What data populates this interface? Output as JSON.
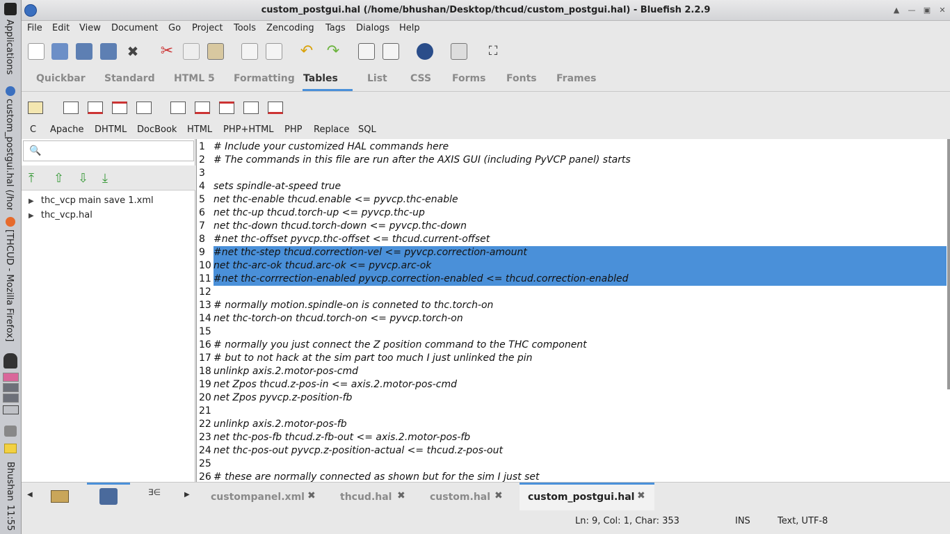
{
  "taskbar": {
    "applications": "Applications",
    "window1": "custom_postgui.hal (/hor",
    "window2": "[THCUD - Mozilla Firefox]",
    "user": "Bhushan",
    "time": "11:55"
  },
  "window": {
    "title": "custom_postgui.hal (/home/bhushan/Desktop/thcud/custom_postgui.hal) - Bluefish 2.2.9"
  },
  "menu": [
    "File",
    "Edit",
    "View",
    "Document",
    "Go",
    "Project",
    "Tools",
    "Zencoding",
    "Tags",
    "Dialogs",
    "Help"
  ],
  "toolbar_icons": [
    "new-file-icon",
    "open-file-icon",
    "save-icon",
    "save-as-icon",
    "close-icon",
    "cut-icon",
    "copy-icon",
    "paste-icon",
    "find-icon",
    "replace-icon",
    "undo-icon",
    "redo-icon",
    "unindent-icon",
    "indent-icon",
    "preview-browser-icon",
    "toggle-view-icon",
    "fullscreen-icon"
  ],
  "quickbar_tabs": [
    "Quickbar",
    "Standard",
    "HTML 5",
    "Formatting",
    "Tables",
    "List",
    "CSS",
    "Forms",
    "Fonts",
    "Frames"
  ],
  "active_tab": "Tables",
  "languages": [
    "C",
    "Apache",
    "DHTML",
    "DocBook",
    "HTML",
    "PHP+HTML",
    "PHP",
    "Replace",
    "SQL"
  ],
  "sidebar": {
    "search_placeholder": "",
    "files": [
      "thc_vcp main save 1.xml",
      "thc_vcp.hal"
    ]
  },
  "editor": {
    "lines": [
      {
        "n": "1",
        "text": "# Include your customized HAL commands here",
        "sel": false
      },
      {
        "n": "2",
        "text": "# The commands in this file are run after the AXIS GUI (including PyVCP panel) starts",
        "sel": false
      },
      {
        "n": "3",
        "text": "",
        "sel": false
      },
      {
        "n": "4",
        "text": "sets spindle-at-speed true",
        "sel": false
      },
      {
        "n": "5",
        "text": "net thc-enable thcud.enable <= pyvcp.thc-enable",
        "sel": false
      },
      {
        "n": "6",
        "text": "net thc-up thcud.torch-up <= pyvcp.thc-up",
        "sel": false
      },
      {
        "n": "7",
        "text": "net thc-down thcud.torch-down <= pyvcp.thc-down",
        "sel": false
      },
      {
        "n": "8",
        "text": "#net thc-offset pyvcp.thc-offset <= thcud.current-offset",
        "sel": false
      },
      {
        "n": "9",
        "text": "#net thc-step thcud.correction-vel <= pyvcp.correction-amount",
        "sel": true
      },
      {
        "n": "10",
        "text": "net thc-arc-ok thcud.arc-ok <= pyvcp.arc-ok",
        "sel": true
      },
      {
        "n": "11",
        "text": "#net thc-corrrection-enabled pyvcp.correction-enabled <= thcud.correction-enabled",
        "sel": true
      },
      {
        "n": "12",
        "text": "",
        "sel": false
      },
      {
        "n": "13",
        "text": "# normally motion.spindle-on is conneted to thc.torch-on",
        "sel": false
      },
      {
        "n": "14",
        "text": "net thc-torch-on thcud.torch-on <= pyvcp.torch-on",
        "sel": false
      },
      {
        "n": "15",
        "text": "",
        "sel": false
      },
      {
        "n": "16",
        "text": "# normally you just connect the Z position command to the THC component",
        "sel": false
      },
      {
        "n": "17",
        "text": "# but to not hack at the sim part too much I just unlinked the pin",
        "sel": false
      },
      {
        "n": "18",
        "text": "unlinkp axis.2.motor-pos-cmd",
        "sel": false
      },
      {
        "n": "19",
        "text": "net Zpos thcud.z-pos-in <= axis.2.motor-pos-cmd",
        "sel": false
      },
      {
        "n": "20",
        "text": "net Zpos pyvcp.z-position-fb",
        "sel": false
      },
      {
        "n": "21",
        "text": "",
        "sel": false
      },
      {
        "n": "22",
        "text": "unlinkp axis.2.motor-pos-fb",
        "sel": false
      },
      {
        "n": "23",
        "text": "net thc-pos-fb thcud.z-fb-out <= axis.2.motor-pos-fb",
        "sel": false
      },
      {
        "n": "24",
        "text": "net thc-pos-out pyvcp.z-position-actual <= thcud.z-pos-out",
        "sel": false
      },
      {
        "n": "25",
        "text": "",
        "sel": false
      },
      {
        "n": "26",
        "text": "# these are normally connected as shown but for the sim I just set",
        "sel": false
      }
    ]
  },
  "doc_tabs": [
    "custompanel.xml",
    "thcud.hal",
    "custom.hal",
    "custom_postgui.hal"
  ],
  "active_doc": "custom_postgui.hal",
  "status": {
    "position": "Ln: 9, Col: 1, Char: 353",
    "mode": "INS",
    "encoding": "Text, UTF-8"
  },
  "colors": {
    "selection": "#4a90d9",
    "accent": "#4a90d9"
  }
}
